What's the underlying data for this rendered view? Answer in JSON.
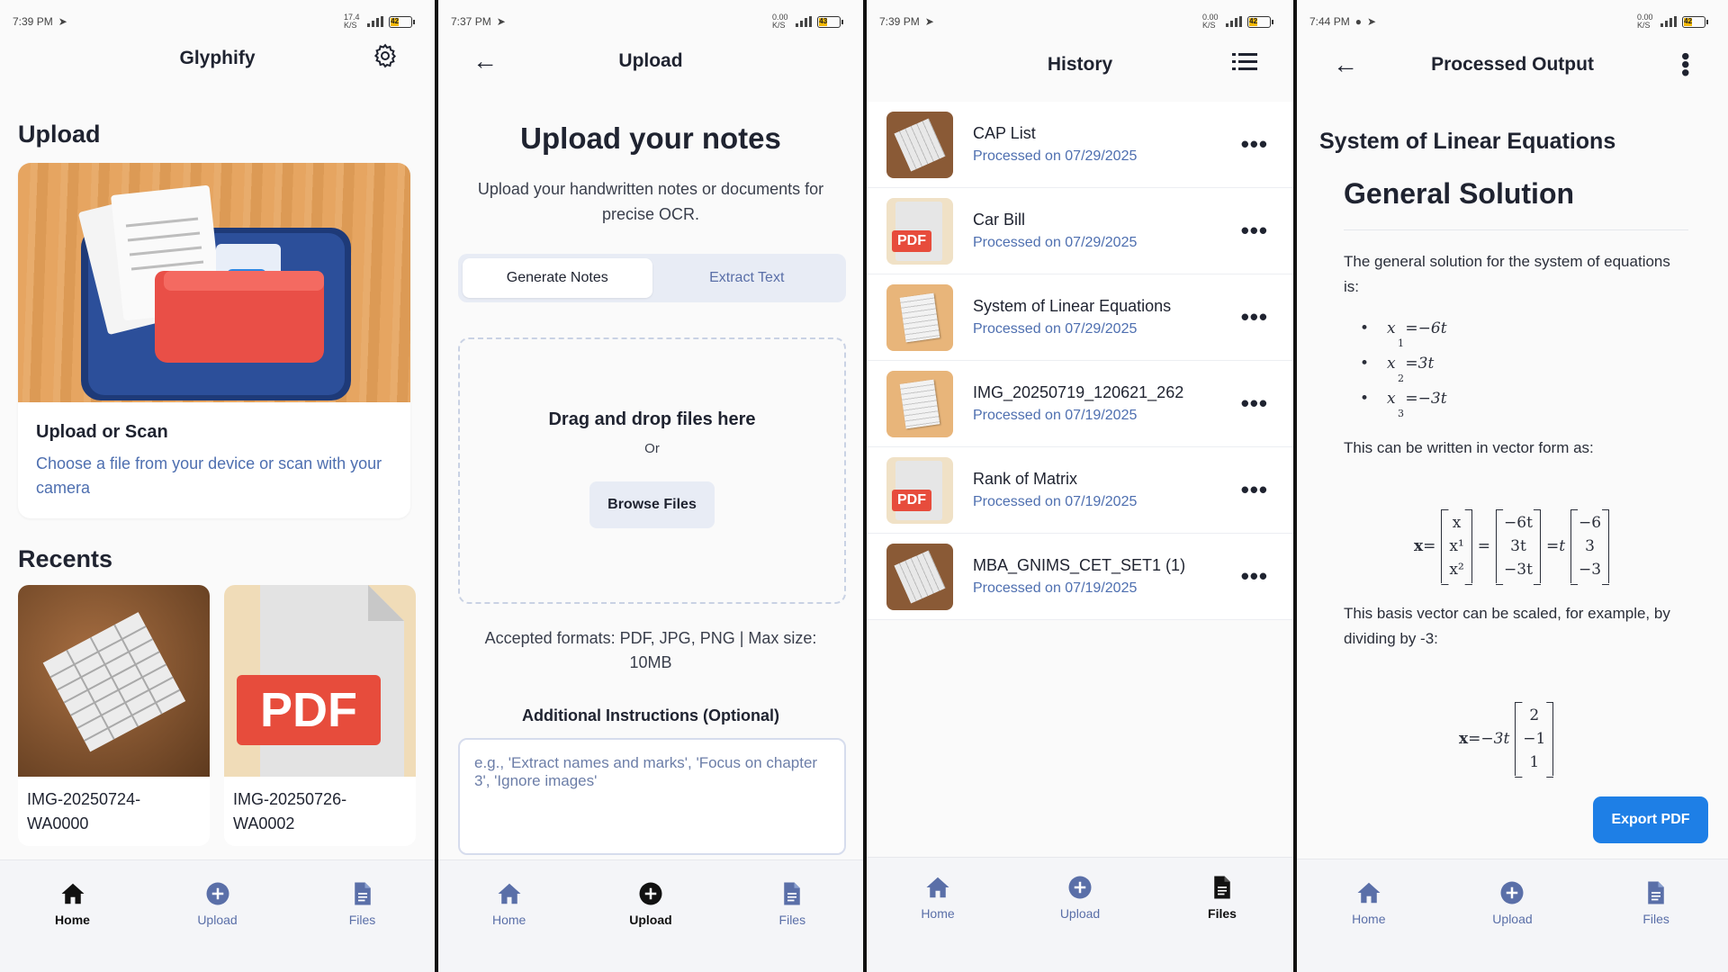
{
  "colors": {
    "accent": "#1e7fe6",
    "link_blue": "#4e6fb0",
    "pdf_red": "#e74c3c"
  },
  "nav": {
    "home": "Home",
    "upload": "Upload",
    "files": "Files"
  },
  "panel1": {
    "status_time": "7:39 PM",
    "status_speed": "17.4 K/S",
    "battery": "42",
    "app_title": "Glyphify",
    "upload_heading": "Upload",
    "card_title": "Upload or Scan",
    "card_desc": "Choose a file from your device or scan with your camera",
    "recents_heading": "Recents",
    "recents": [
      {
        "name": "IMG-20250724-WA0000",
        "icon": "spreadsheet-paper-icon"
      },
      {
        "name": "IMG-20250726-WA0002",
        "icon": "pdf-file-icon",
        "tag": "PDF"
      }
    ]
  },
  "panel2": {
    "status_time": "7:37 PM",
    "status_speed": "0.00 K/S",
    "battery": "43",
    "header": "Upload",
    "title": "Upload your notes",
    "subtitle": "Upload your handwritten notes or documents for precise OCR.",
    "tabs": [
      "Generate Notes",
      "Extract Text"
    ],
    "active_tab": "Generate Notes",
    "drop_title": "Drag and drop files here",
    "drop_or": "Or",
    "browse": "Browse Files",
    "formats": "Accepted formats: PDF, JPG, PNG | Max size: 10MB",
    "instructions_label": "Additional Instructions (Optional)",
    "instructions_placeholder": "e.g., 'Extract names and marks', 'Focus on chapter 3', 'Ignore images'"
  },
  "panel3": {
    "status_time": "7:39 PM",
    "status_speed": "0.00 K/S",
    "battery": "42",
    "header": "History",
    "items": [
      {
        "name": "CAP List",
        "date": "Processed on 07/29/2025",
        "thumb": "dark"
      },
      {
        "name": "Car Bill",
        "date": "Processed on 07/29/2025",
        "thumb": "pdf",
        "tag": "PDF"
      },
      {
        "name": "System of Linear Equations",
        "date": "Processed on 07/29/2025",
        "thumb": "paper"
      },
      {
        "name": "IMG_20250719_120621_262",
        "date": "Processed on 07/19/2025",
        "thumb": "paper"
      },
      {
        "name": "Rank of Matrix",
        "date": "Processed on 07/19/2025",
        "thumb": "pdf",
        "tag": "PDF"
      },
      {
        "name": "MBA_GNIMS_CET_SET1 (1)",
        "date": "Processed on 07/19/2025",
        "thumb": "dark"
      }
    ]
  },
  "panel4": {
    "status_time": "7:44 PM",
    "status_speed": "0.00 K/S",
    "battery": "42",
    "header": "Processed Output",
    "doc_title": "System of Linear Equations",
    "section": "General Solution",
    "intro": "The general solution for the system of equations is:",
    "solutions": [
      {
        "lhs": "x",
        "sub": "1",
        "rhs": "=−6t"
      },
      {
        "lhs": "x",
        "sub": "2",
        "rhs": "=3t"
      },
      {
        "lhs": "x",
        "sub": "3",
        "rhs": "=−3t"
      }
    ],
    "vector_intro": "This can be written in vector form as:",
    "vector_eq": {
      "lhs": "x",
      "vec1": [
        "x",
        "x¹",
        "x²"
      ],
      "vec2": [
        "−6t",
        "3t",
        "−3t"
      ],
      "scalar": "t",
      "vec3": [
        "−6",
        "3",
        "−3"
      ]
    },
    "scale_text": "This basis vector can be scaled, for example, by dividing by -3:",
    "scaled_eq": {
      "lhs": "x",
      "scalar": "−3t",
      "vec": [
        "2",
        "−1",
        "1"
      ]
    },
    "export": "Export PDF"
  }
}
